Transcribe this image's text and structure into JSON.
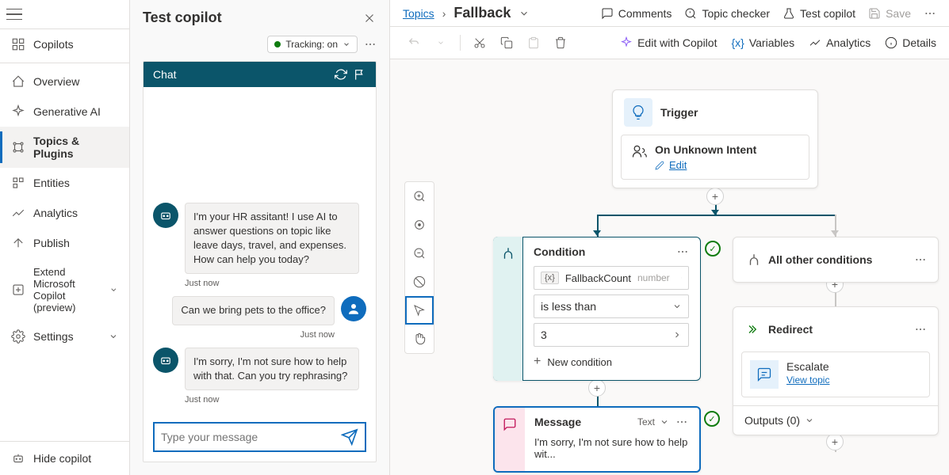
{
  "sidebar": {
    "copilots": "Copilots",
    "overview": "Overview",
    "generative": "Generative AI",
    "topics": "Topics & Plugins",
    "entities": "Entities",
    "analytics": "Analytics",
    "publish": "Publish",
    "extend1": "Extend Microsoft",
    "extend2": "Copilot (preview)",
    "settings": "Settings",
    "hide": "Hide copilot"
  },
  "test": {
    "title": "Test copilot",
    "tracking": "Tracking: on",
    "chat_header": "Chat",
    "msg1": "I'm your HR assitant! I use AI to answer questions on topic like leave days, travel, and expenses. How can help you today?",
    "ts1": "Just now",
    "msg2": "Can we bring pets to the office?",
    "ts2": "Just now",
    "msg3": "I'm sorry, I'm not sure how to help with that. Can you try rephrasing?",
    "ts3": "Just now",
    "placeholder": "Type your message"
  },
  "topbar": {
    "topics": "Topics",
    "current": "Fallback",
    "comments": "Comments",
    "checker": "Topic checker",
    "test": "Test copilot",
    "save": "Save"
  },
  "toolbar": {
    "edit_copilot": "Edit with Copilot",
    "variables": "Variables",
    "analytics": "Analytics",
    "details": "Details"
  },
  "nodes": {
    "trigger": {
      "title": "Trigger",
      "subtitle": "On Unknown Intent",
      "edit": "Edit"
    },
    "condition": {
      "title": "Condition",
      "var": "FallbackCount",
      "type": "number",
      "op": "is less than",
      "val": "3",
      "new": "New condition"
    },
    "other": {
      "title": "All other conditions"
    },
    "redirect": {
      "title": "Redirect",
      "escalate": "Escalate",
      "view": "View topic",
      "outputs": "Outputs (0)"
    },
    "message": {
      "title": "Message",
      "type": "Text",
      "body": "I'm sorry, I'm not sure how to help wit..."
    }
  }
}
